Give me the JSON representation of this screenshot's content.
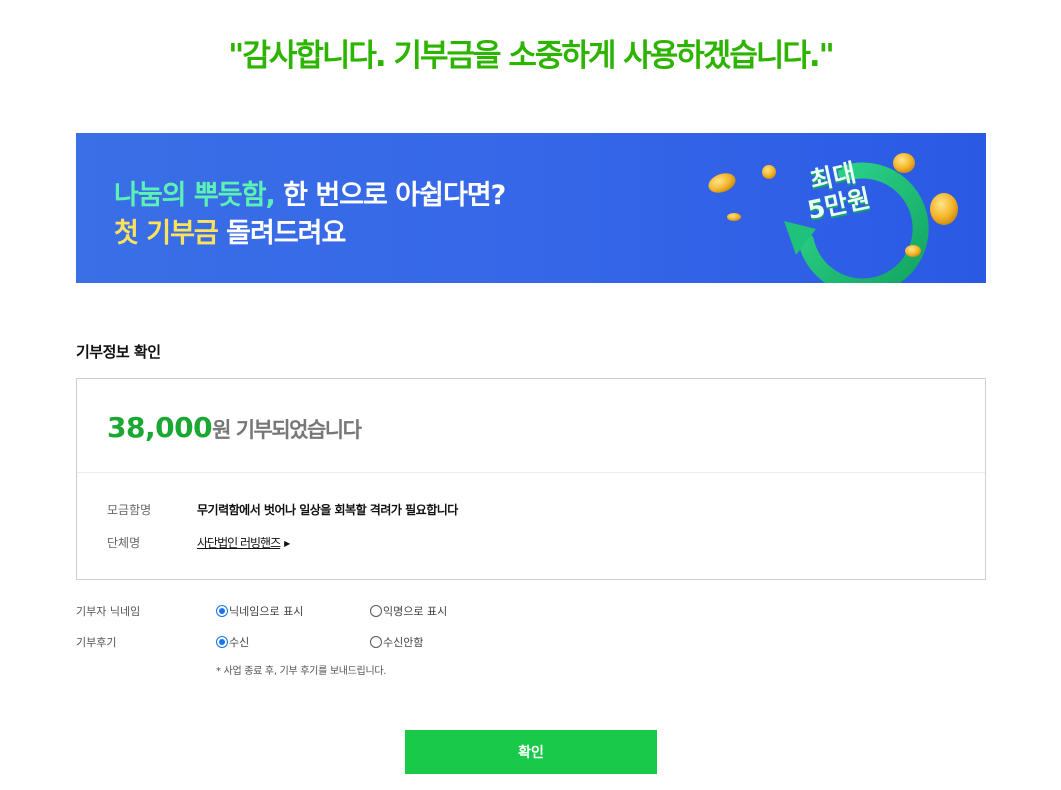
{
  "header": {
    "thanks_message": "\"감사합니다. 기부금을 소중하게 사용하겠습니다.\""
  },
  "banner": {
    "line1_highlight": "나눔의 뿌듯함,",
    "line1_rest": " 한 번으로 아쉽다면?",
    "line2_highlight": "첫 기부금",
    "line2_rest": " 돌려드려요",
    "badge_line1": "최대",
    "badge_line2": "5만원"
  },
  "donation_info": {
    "section_title": "기부정보 확인",
    "amount": "38,000",
    "amount_suffix": "원 기부되었습니다",
    "fundraising_label": "모금함명",
    "fundraising_value": "무기력함에서 벗어나 일상을 회복할 격려가 필요합니다",
    "organization_label": "단체명",
    "organization_value": "사단법인 러빙핸즈"
  },
  "options": {
    "nickname": {
      "label": "기부자 닉네임",
      "option_a": "닉네임으로 표시",
      "option_b": "익명으로 표시",
      "selected": "option_a"
    },
    "review": {
      "label": "기부후기",
      "option_a": "수신",
      "option_b": "수신안함",
      "selected": "option_a"
    },
    "note": "* 사업 종료 후, 기부 후기를 보내드립니다."
  },
  "confirm_button": {
    "label": "확인"
  },
  "colors": {
    "brand_green": "#2db400",
    "amount_green": "#1aa832",
    "button_green": "#19c94a",
    "banner_blue": "#3566e8",
    "radio_blue": "#1a73e8"
  }
}
